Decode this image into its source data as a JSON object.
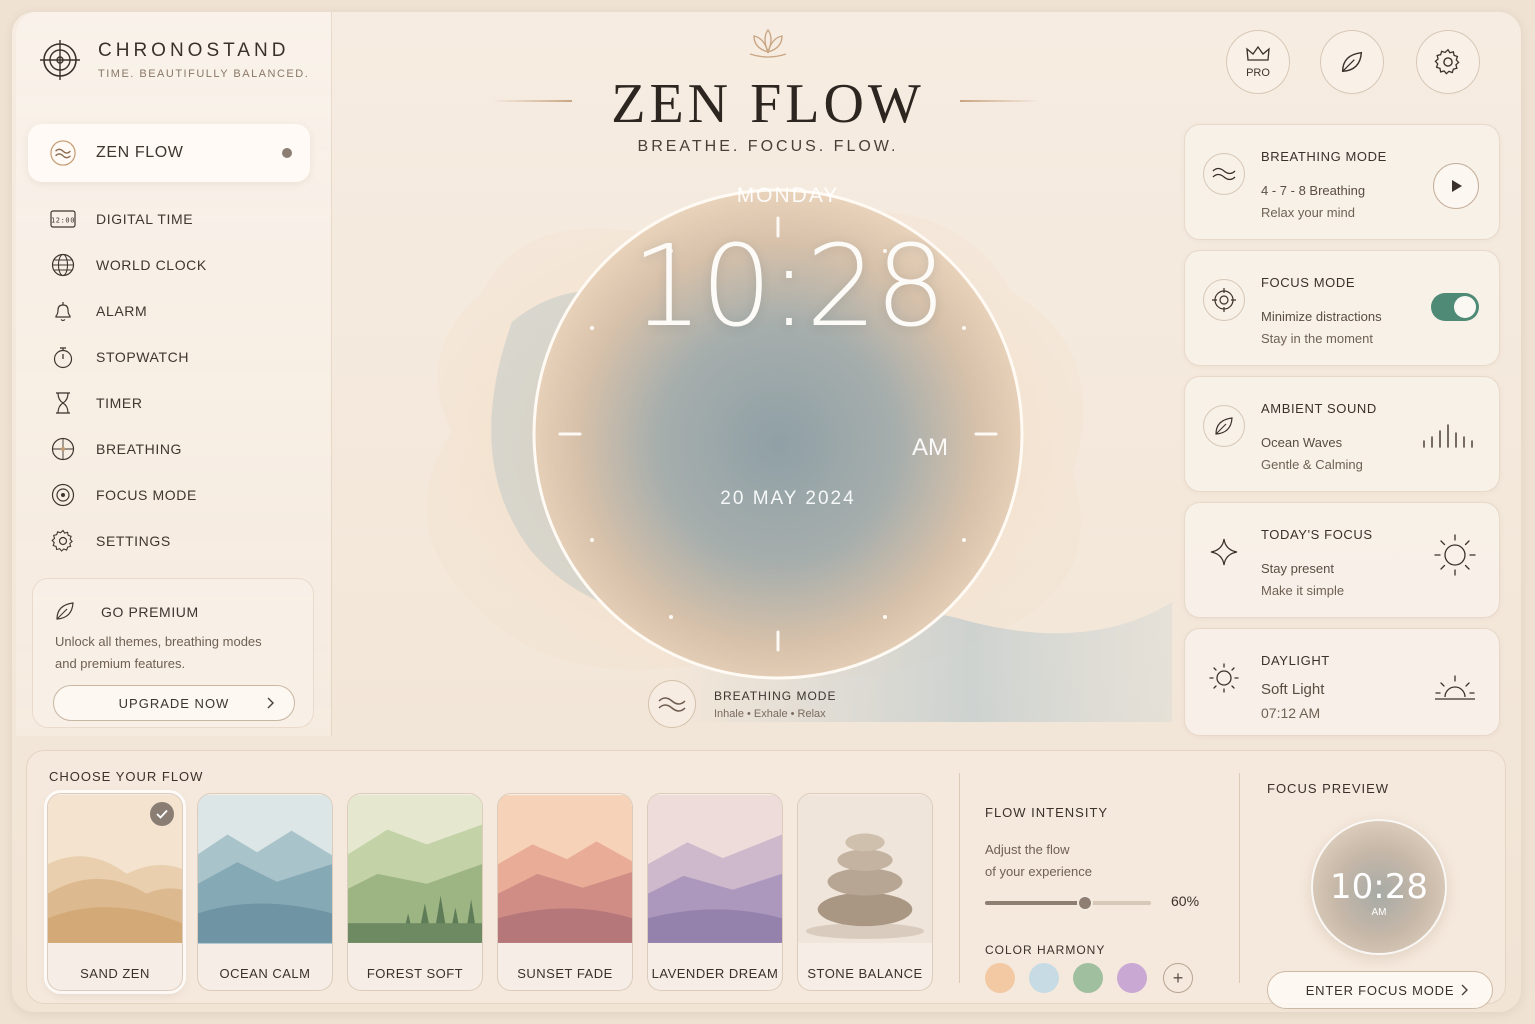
{
  "brand": {
    "name": "CHRONOSTAND",
    "tagline": "TIME. BEAUTIFULLY BALANCED."
  },
  "nav": {
    "items": [
      {
        "label": "ZEN FLOW",
        "icon": "waves-icon",
        "active": true
      },
      {
        "label": "DIGITAL TIME",
        "icon": "digital-clock-icon",
        "icon_text": "12:00"
      },
      {
        "label": "WORLD CLOCK",
        "icon": "globe-icon"
      },
      {
        "label": "ALARM",
        "icon": "bell-icon"
      },
      {
        "label": "STOPWATCH",
        "icon": "stopwatch-icon"
      },
      {
        "label": "TIMER",
        "icon": "hourglass-icon"
      },
      {
        "label": "BREATHING",
        "icon": "breathing-icon"
      },
      {
        "label": "FOCUS MODE",
        "icon": "target-icon"
      },
      {
        "label": "SETTINGS",
        "icon": "gear-icon"
      }
    ]
  },
  "premium": {
    "title": "GO PREMIUM",
    "description": "Unlock all themes, breathing modes and premium features.",
    "button": "UPGRADE NOW"
  },
  "header": {
    "title": "ZEN FLOW",
    "subtitle": "BREATHE. FOCUS. FLOW.",
    "pro_label": "PRO"
  },
  "clock": {
    "day": "MONDAY",
    "time": "10:28",
    "ampm": "AM",
    "date": "20 MAY 2024"
  },
  "breathing_mini": {
    "title": "BREATHING MODE",
    "subtitle": "Inhale • Exhale • Relax"
  },
  "cards": {
    "breathing": {
      "title": "BREATHING MODE",
      "line1": "4 - 7 - 8 Breathing",
      "line2": "Relax your mind"
    },
    "focus": {
      "title": "FOCUS MODE",
      "line1": "Minimize distractions",
      "line2": "Stay in the moment",
      "enabled": true
    },
    "ambient": {
      "title": "AMBIENT SOUND",
      "line1": "Ocean Waves",
      "line2": "Gentle & Calming"
    },
    "today": {
      "title": "TODAY'S FOCUS",
      "line1": "Stay present",
      "line2": "Make it simple"
    },
    "daylight": {
      "title": "DAYLIGHT",
      "line1": "Soft Light",
      "line2": "07:12 AM"
    }
  },
  "flows": {
    "title": "CHOOSE YOUR FLOW",
    "items": [
      {
        "label": "SAND ZEN",
        "selected": true
      },
      {
        "label": "OCEAN CALM"
      },
      {
        "label": "FOREST SOFT"
      },
      {
        "label": "SUNSET FADE"
      },
      {
        "label": "LAVENDER DREAM"
      },
      {
        "label": "STONE BALANCE"
      }
    ]
  },
  "intensity": {
    "title": "FLOW INTENSITY",
    "description_line1": "Adjust the flow",
    "description_line2": "of your experience",
    "value": 60,
    "value_label": "60%",
    "harmony_title": "COLOR HARMONY",
    "swatches": [
      "#f2c9a2",
      "#c6dbe4",
      "#9fbf9f",
      "#c9a8d3"
    ]
  },
  "preview": {
    "title": "FOCUS PREVIEW",
    "time": "10:28",
    "ampm": "AM",
    "button": "ENTER FOCUS MODE"
  },
  "colors": {
    "accent_green": "#4f8a76",
    "brand_brown": "#3a312b",
    "gold": "#c9a684"
  }
}
